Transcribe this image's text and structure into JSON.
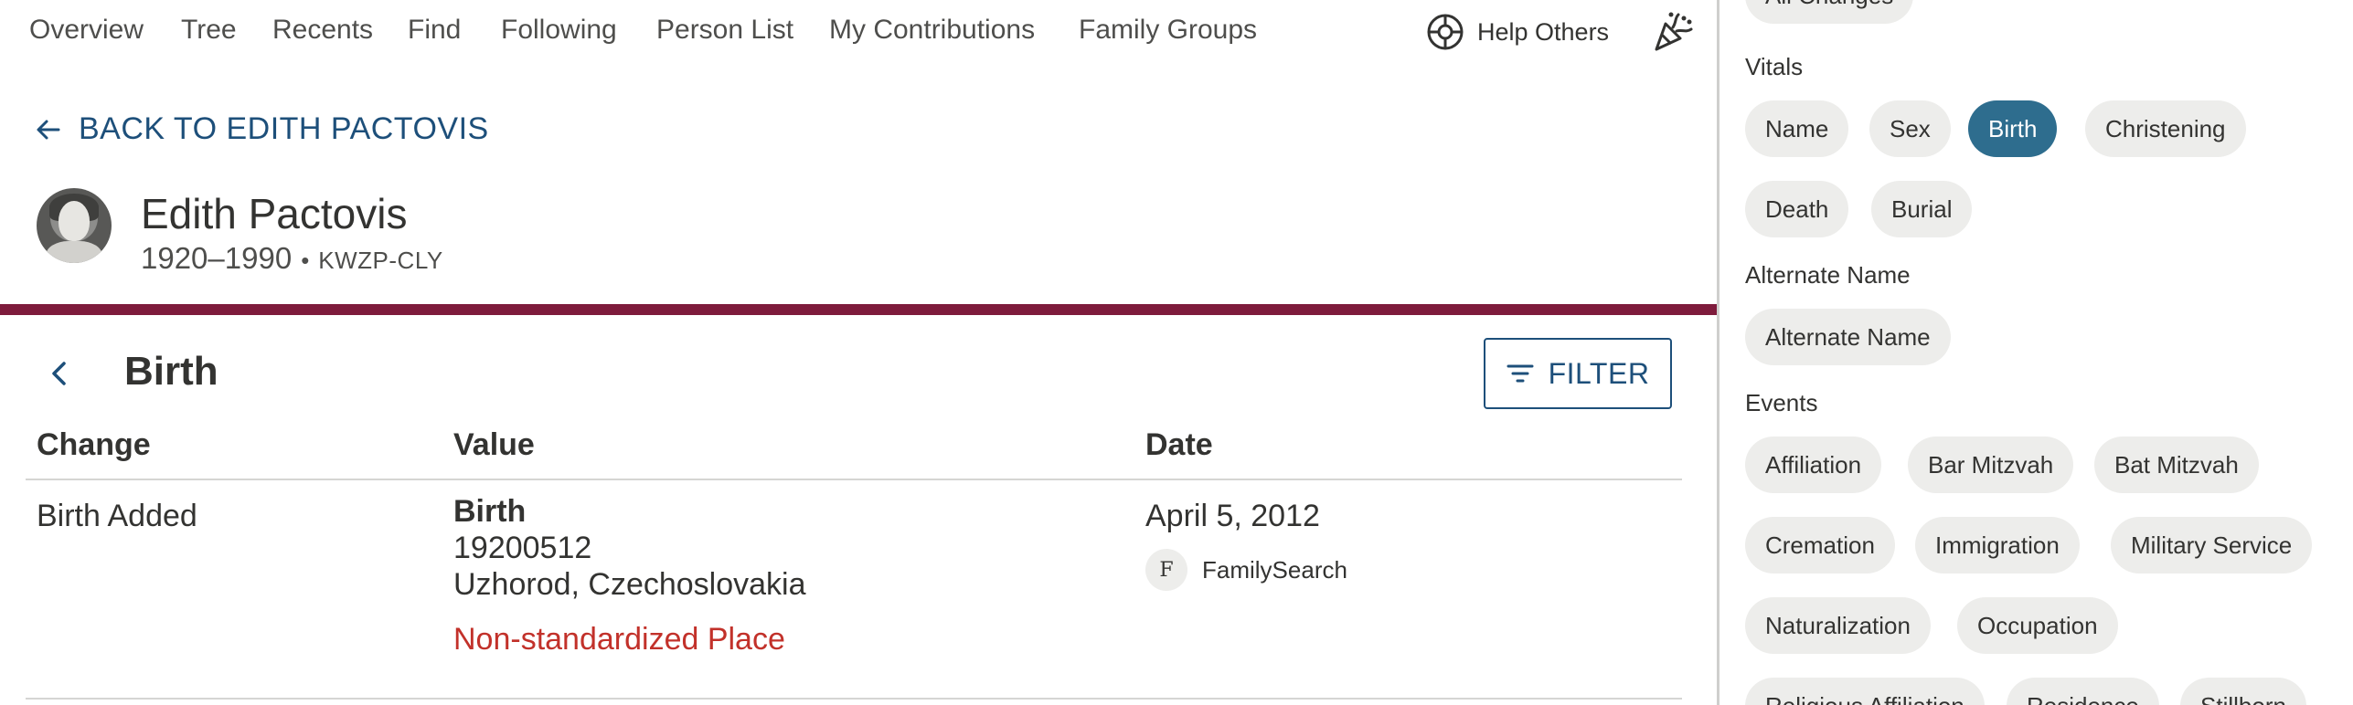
{
  "nav": {
    "items": [
      "Overview",
      "Tree",
      "Recents",
      "Find",
      "Following",
      "Person List",
      "My Contributions",
      "Family Groups"
    ],
    "help_others": "Help Others"
  },
  "back_link": "BACK TO EDITH PACTOVIS",
  "person": {
    "name": "Edith Pactovis",
    "years": "1920–1990",
    "separator": "•",
    "pid": "KWZP-CLY"
  },
  "section": {
    "title": "Birth",
    "filter_label": "FILTER"
  },
  "table": {
    "headers": [
      "Change",
      "Value",
      "Date"
    ],
    "rows": [
      {
        "change": "Birth Added",
        "value_title": "Birth",
        "value_date": "19200512",
        "value_place": "Uzhorod, Czechoslovakia",
        "value_warning": "Non-standardized Place",
        "date": "April 5, 2012",
        "contributor_initial": "F",
        "contributor": "FamilySearch"
      }
    ]
  },
  "filters": {
    "all_changes": "All Changes",
    "groups": [
      {
        "label": "Vitals",
        "chips": [
          "Name",
          "Sex",
          "Birth",
          "Christening",
          "Death",
          "Burial"
        ],
        "active": "Birth"
      },
      {
        "label": "Alternate Name",
        "chips": [
          "Alternate Name"
        ]
      },
      {
        "label": "Events",
        "chips": [
          "Affiliation",
          "Bar Mitzvah",
          "Bat Mitzvah",
          "Cremation",
          "Immigration",
          "Military Service",
          "Naturalization",
          "Occupation",
          "Religious Affiliation",
          "Residence",
          "Stillborn"
        ]
      }
    ]
  },
  "colors": {
    "accent_blue": "#1d4f7a",
    "active_chip": "#2e6d8e",
    "maroon_bar": "#7e1b3c",
    "warning_red": "#c2312a"
  }
}
